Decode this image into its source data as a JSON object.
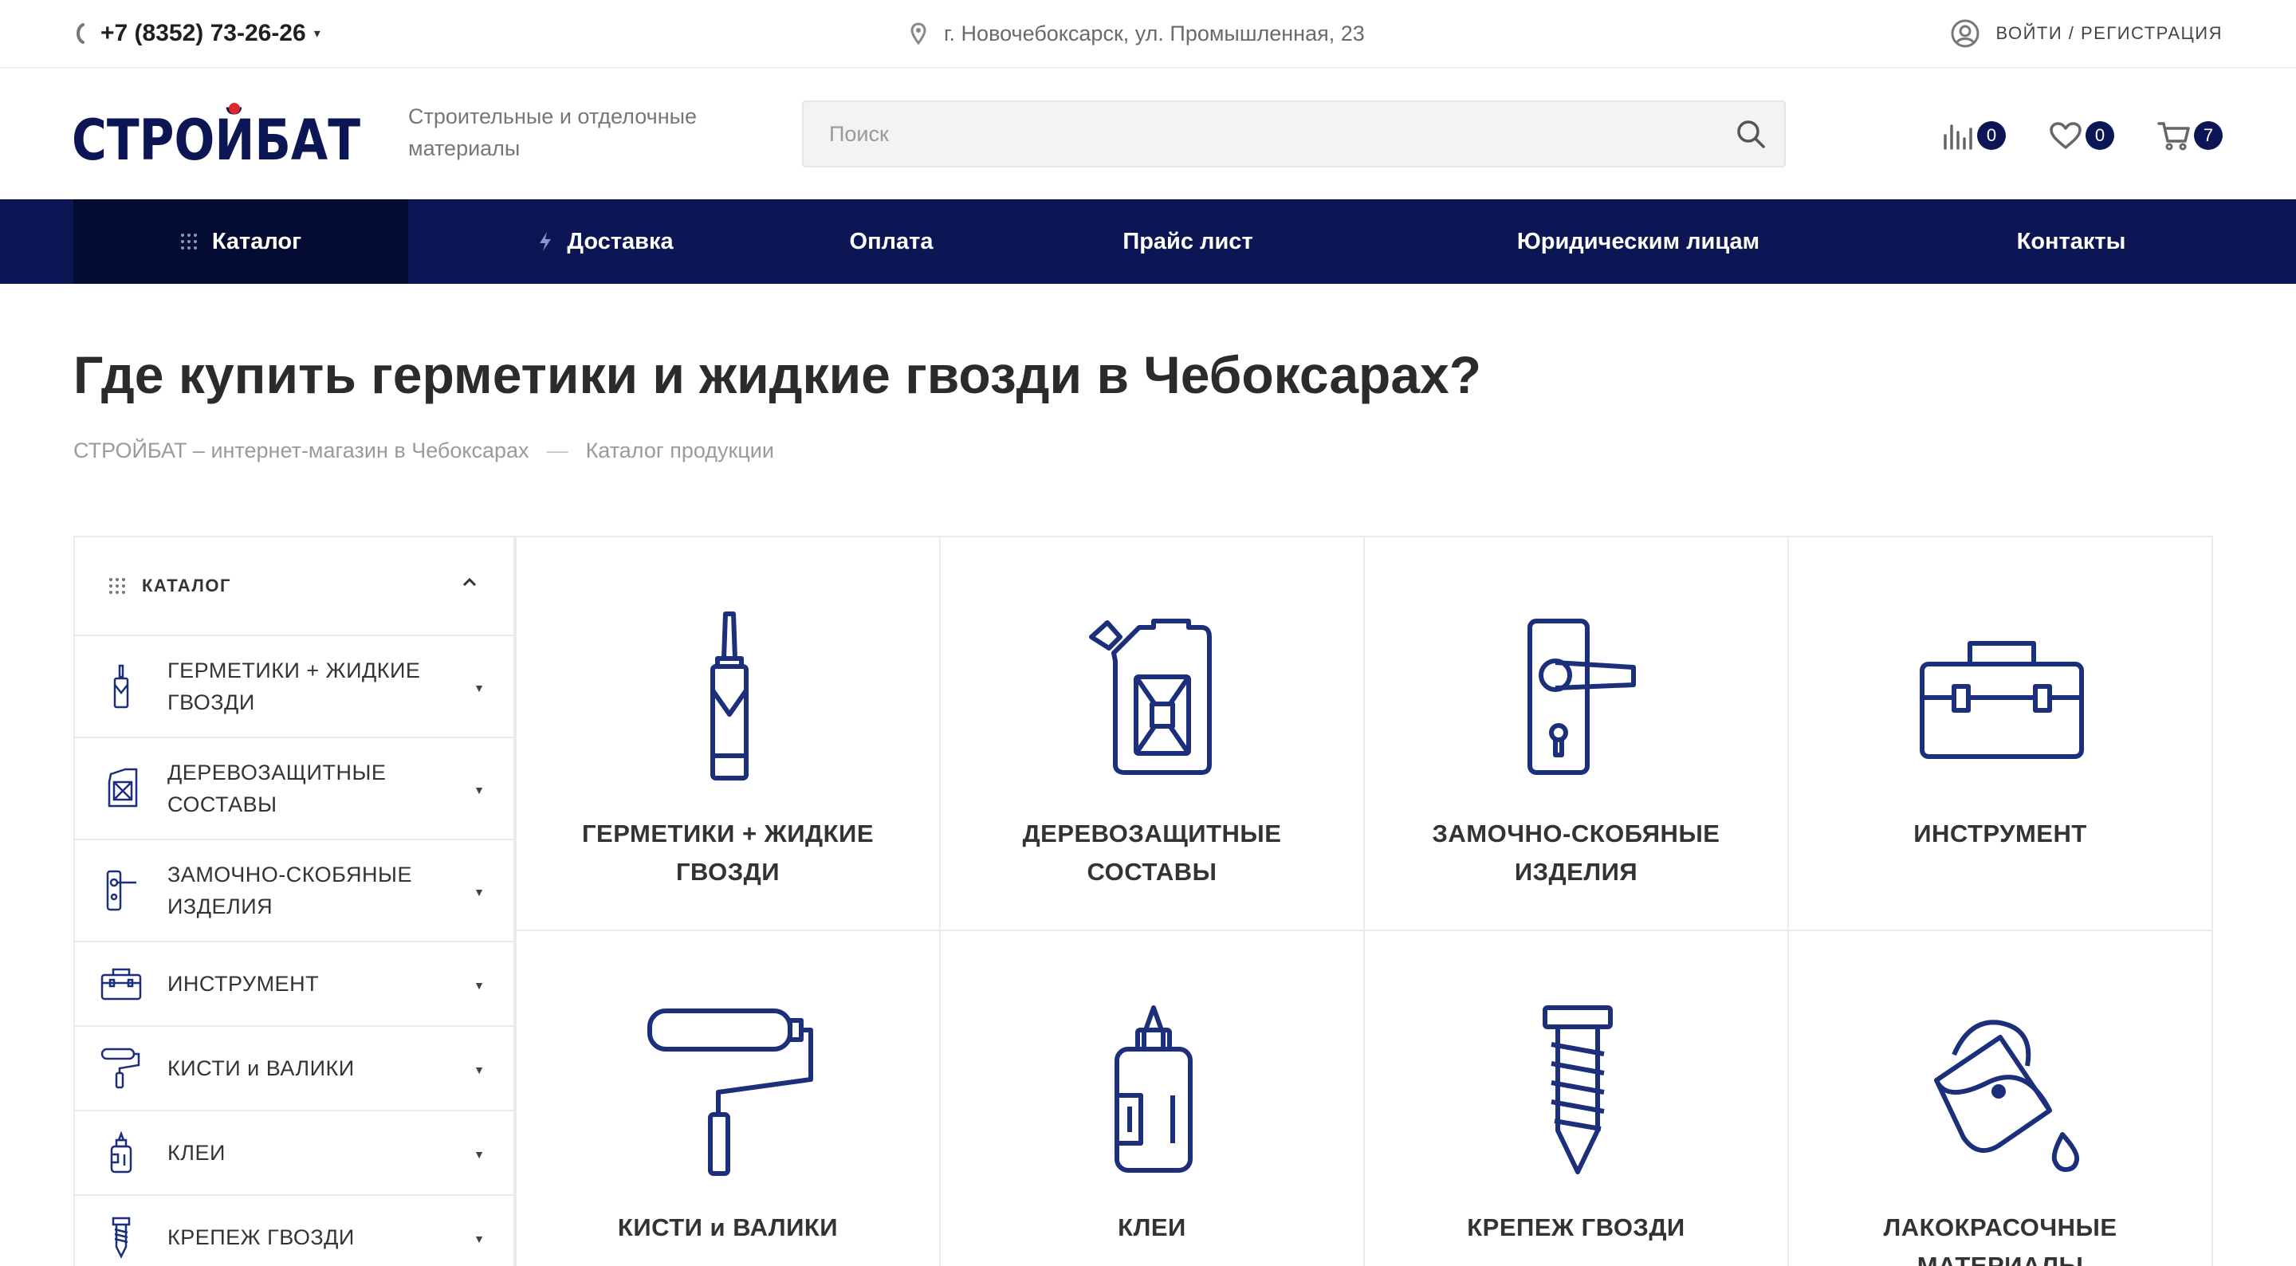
{
  "topbar": {
    "phone": "+7 (8352) 73-26-26",
    "address": "г. Новочебоксарск, ул. Промышленная, 23",
    "login": "ВОЙТИ / РЕГИСТРАЦИЯ"
  },
  "header": {
    "logo_text": "СТРОЙБАТ",
    "tagline_line1": "Строительные и отделочные",
    "tagline_line2": "материалы",
    "search_placeholder": "Поиск",
    "compare_count": "0",
    "favorites_count": "0",
    "cart_count": "7"
  },
  "nav": {
    "items": [
      "Каталог",
      "Доставка",
      "Оплата",
      "Прайс лист",
      "Юридическим лицам",
      "Контакты"
    ]
  },
  "page": {
    "title": "Где купить герметики и жидкие гвозди в Чебоксарах?",
    "breadcrumbs": [
      "СТРОЙБАТ – интернет-магазин в Чебоксарах",
      "Каталог продукции"
    ],
    "breadcrumb_separator": "—"
  },
  "sidebar": {
    "title": "КАТАЛОГ",
    "items": [
      {
        "line1": "ГЕРМЕТИКИ + ЖИДКИЕ",
        "line2": "ГВОЗДИ",
        "icon": "sealant-icon"
      },
      {
        "line1": "ДЕРЕВОЗАЩИТНЫЕ",
        "line2": "СОСТАВЫ",
        "icon": "canister-icon"
      },
      {
        "line1": "ЗАМОЧНО-СКОБЯНЫЕ",
        "line2": "ИЗДЕЛИЯ",
        "icon": "door-handle-icon"
      },
      {
        "line1": "ИНСТРУМЕНТ",
        "line2": "",
        "icon": "toolbox-icon"
      },
      {
        "line1": "КИСТИ и ВАЛИКИ",
        "line2": "",
        "icon": "paint-roller-icon"
      },
      {
        "line1": "КЛЕИ",
        "line2": "",
        "icon": "glue-bottle-icon"
      },
      {
        "line1": "КРЕПЕЖ ГВОЗДИ",
        "line2": "",
        "icon": "screw-icon"
      }
    ]
  },
  "categories": [
    {
      "line1": "ГЕРМЕТИКИ + ЖИДКИЕ",
      "line2": "ГВОЗДИ",
      "icon": "sealant-icon"
    },
    {
      "line1": "ДЕРЕВОЗАЩИТНЫЕ",
      "line2": "СОСТАВЫ",
      "icon": "canister-icon"
    },
    {
      "line1": "ЗАМОЧНО-СКОБЯНЫЕ",
      "line2": "ИЗДЕЛИЯ",
      "icon": "door-handle-icon"
    },
    {
      "line1": "ИНСТРУМЕНТ",
      "line2": "",
      "icon": "toolbox-icon"
    },
    {
      "line1": "КИСТИ и ВАЛИКИ",
      "line2": "",
      "icon": "paint-roller-icon"
    },
    {
      "line1": "КЛЕИ",
      "line2": "",
      "icon": "glue-bottle-icon"
    },
    {
      "line1": "КРЕПЕЖ ГВОЗДИ",
      "line2": "",
      "icon": "screw-icon"
    },
    {
      "line1": "ЛАКОКРАСОЧНЫЕ",
      "line2": "МАТЕРИАЛЫ",
      "icon": "paint-bucket-icon"
    }
  ],
  "colors": {
    "brand_navy": "#0c1654",
    "nav_active": "#050c33",
    "logo_dot": "#e0252f",
    "icon_stroke": "#1b2f7a"
  }
}
